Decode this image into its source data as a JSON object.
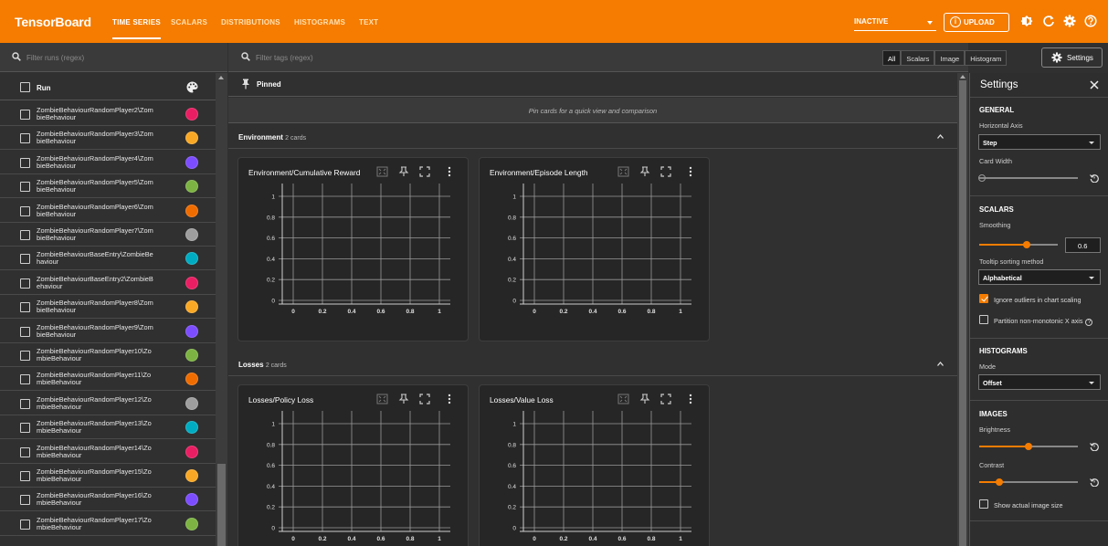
{
  "app": {
    "title": "TensorBoard"
  },
  "nav": {
    "tabs": [
      {
        "label": "TIME SERIES",
        "active": true
      },
      {
        "label": "SCALARS"
      },
      {
        "label": "DISTRIBUTIONS"
      },
      {
        "label": "HISTOGRAMS"
      },
      {
        "label": "TEXT"
      }
    ]
  },
  "topbar": {
    "status": "INACTIVE",
    "upload_label": "UPLOAD",
    "upload_icon": "i",
    "brand_color": "#f57c00"
  },
  "runs": {
    "filter_placeholder": "Filter runs (regex)",
    "header_label": "Run",
    "items": [
      {
        "name": "ZombieBehaviourRandomPlayer2\\ZombieBehaviour",
        "color": "#e91e63"
      },
      {
        "name": "ZombieBehaviourRandomPlayer3\\ZombieBehaviour",
        "color": "#f9a825"
      },
      {
        "name": "ZombieBehaviourRandomPlayer4\\ZombieBehaviour",
        "color": "#7c4dff"
      },
      {
        "name": "ZombieBehaviourRandomPlayer5\\ZombieBehaviour",
        "color": "#7cb342"
      },
      {
        "name": "ZombieBehaviourRandomPlayer6\\ZombieBehaviour",
        "color": "#ef6c00"
      },
      {
        "name": "ZombieBehaviourRandomPlayer7\\ZombieBehaviour",
        "color": "#9e9e9e"
      },
      {
        "name": "ZombieBehaviourBaseEntry\\ZombieBehaviour",
        "color": "#00acc1"
      },
      {
        "name": "ZombieBehaviourBaseEntry2\\ZombieBehaviour",
        "color": "#e91e63"
      },
      {
        "name": "ZombieBehaviourRandomPlayer8\\ZombieBehaviour",
        "color": "#f9a825"
      },
      {
        "name": "ZombieBehaviourRandomPlayer9\\ZombieBehaviour",
        "color": "#7c4dff"
      },
      {
        "name": "ZombieBehaviourRandomPlayer10\\ZombieBehaviour",
        "color": "#7cb342"
      },
      {
        "name": "ZombieBehaviourRandomPlayer11\\ZombieBehaviour",
        "color": "#ef6c00"
      },
      {
        "name": "ZombieBehaviourRandomPlayer12\\ZombieBehaviour",
        "color": "#9e9e9e"
      },
      {
        "name": "ZombieBehaviourRandomPlayer13\\ZombieBehaviour",
        "color": "#00acc1"
      },
      {
        "name": "ZombieBehaviourRandomPlayer14\\ZombieBehaviour",
        "color": "#e91e63"
      },
      {
        "name": "ZombieBehaviourRandomPlayer15\\ZombieBehaviour",
        "color": "#f9a825"
      },
      {
        "name": "ZombieBehaviourRandomPlayer16\\ZombieBehaviour",
        "color": "#7c4dff"
      },
      {
        "name": "ZombieBehaviourRandomPlayer17\\ZombieBehaviour",
        "color": "#7cb342"
      }
    ]
  },
  "main": {
    "filter_placeholder": "Filter tags (regex)",
    "type_filters": [
      "All",
      "Scalars",
      "Image",
      "Histogram"
    ],
    "settings_button": "Settings",
    "pinned_label": "Pinned",
    "pinned_empty": "Pin cards for a quick view and comparison",
    "groups": [
      {
        "name": "Environment",
        "count": "2 cards",
        "cards": [
          {
            "title": "Environment/Cumulative Reward"
          },
          {
            "title": "Environment/Episode Length"
          }
        ]
      },
      {
        "name": "Losses",
        "count": "2 cards",
        "cards": [
          {
            "title": "Losses/Policy Loss"
          },
          {
            "title": "Losses/Value Loss"
          }
        ]
      }
    ],
    "plot": {
      "y_ticks": [
        "1",
        "0.8",
        "0.6",
        "0.4",
        "0.2",
        "0"
      ],
      "x_ticks": [
        "0",
        "0.2",
        "0.4",
        "0.6",
        "0.8",
        "1"
      ]
    }
  },
  "settings_panel": {
    "title": "Settings",
    "general": {
      "heading": "GENERAL",
      "horizontal_axis_label": "Horizontal Axis",
      "horizontal_axis_value": "Step",
      "card_width_label": "Card Width"
    },
    "scalars": {
      "heading": "SCALARS",
      "smoothing_label": "Smoothing",
      "smoothing_value": "0.6",
      "smoothing_fraction": 0.6,
      "tooltip_label": "Tooltip sorting method",
      "tooltip_value": "Alphabetical",
      "ignore_outliers_label": "Ignore outliers in chart scaling",
      "ignore_outliers_checked": true,
      "partition_label": "Partition non-monotonic X axis",
      "partition_checked": false,
      "partition_help": "?"
    },
    "histograms": {
      "heading": "HISTOGRAMS",
      "mode_label": "Mode",
      "mode_value": "Offset"
    },
    "images": {
      "heading": "IMAGES",
      "brightness_label": "Brightness",
      "brightness_fraction": 0.5,
      "contrast_label": "Contrast",
      "contrast_fraction": 0.2,
      "actual_size_label": "Show actual image size",
      "actual_size_checked": false
    }
  }
}
